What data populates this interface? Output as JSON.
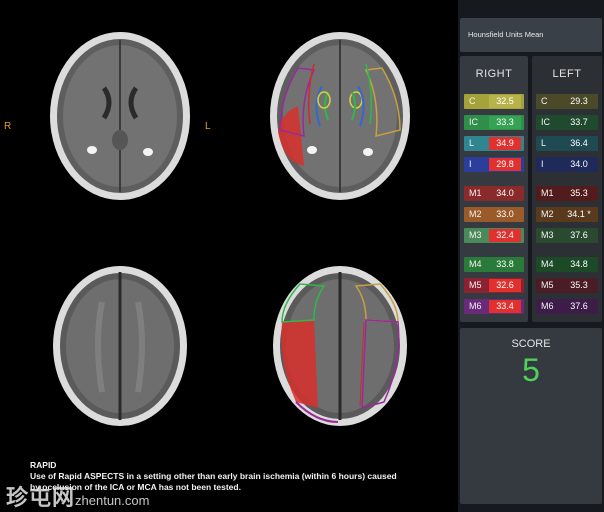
{
  "viewer": {
    "right_marker": "R",
    "left_marker": "L",
    "footer_title": "RAPID",
    "footer_line1": "Use of Rapid ASPECTS in a setting other than early brain ischemia (within 6 hours) caused",
    "footer_line2": "by occlusion of the ICA or MCA has not been tested."
  },
  "watermark": {
    "main": "珍屯网",
    "url": "zhentun.com"
  },
  "panel": {
    "header": "Hounsfield Units Mean",
    "right_title": "RIGHT",
    "left_title": "LEFT",
    "right_rows": [
      {
        "label": "C",
        "value": "32.5",
        "bg": "#a6a23a",
        "pill": "#b7b34a"
      },
      {
        "label": "IC",
        "value": "33.3",
        "bg": "#2f8f4a",
        "pill": "#36a253"
      },
      {
        "label": "L",
        "value": "34.9",
        "bg": "#2f8590",
        "pill": "#e2302e"
      },
      {
        "label": "I",
        "value": "29.8",
        "bg": "#2c3e9c",
        "pill": "#e2302e"
      },
      {
        "label": "M1",
        "value": "34.0",
        "bg": "#8a2a2a",
        "pill": "#8a2a2a"
      },
      {
        "label": "M2",
        "value": "33.0",
        "bg": "#9a5a2a",
        "pill": "#9a5a2a"
      },
      {
        "label": "M3",
        "value": "32.4",
        "bg": "#4a8a5a",
        "pill": "#e2302e"
      },
      {
        "label": "M4",
        "value": "33.8",
        "bg": "#2a7a3a",
        "pill": "#2a7a3a"
      },
      {
        "label": "M5",
        "value": "32.6",
        "bg": "#8a2232",
        "pill": "#e2302e"
      },
      {
        "label": "M6",
        "value": "33.4",
        "bg": "#6a2a7a",
        "pill": "#e2302e"
      }
    ],
    "left_rows": [
      {
        "label": "C",
        "value": "29.3",
        "bg": "#4a4a28",
        "pill": "#4a4a28"
      },
      {
        "label": "IC",
        "value": "33.7",
        "bg": "#1f4a2e",
        "pill": "#1f4a2e"
      },
      {
        "label": "L",
        "value": "36.4",
        "bg": "#1f4a52",
        "pill": "#1f4a52"
      },
      {
        "label": "I",
        "value": "34.0",
        "bg": "#1f2a5a",
        "pill": "#1f2a5a"
      },
      {
        "label": "M1",
        "value": "35.3",
        "bg": "#521c1c",
        "pill": "#521c1c"
      },
      {
        "label": "M2",
        "value": "34.1 *",
        "bg": "#5a3a1c",
        "pill": "#5a3a1c"
      },
      {
        "label": "M3",
        "value": "37.6",
        "bg": "#2a4a30",
        "pill": "#2a4a30"
      },
      {
        "label": "M4",
        "value": "34.8",
        "bg": "#1c4a26",
        "pill": "#1c4a26"
      },
      {
        "label": "M5",
        "value": "35.3",
        "bg": "#4a1c24",
        "pill": "#4a1c24"
      },
      {
        "label": "M6",
        "value": "37.6",
        "bg": "#3e1c4a",
        "pill": "#3e1c4a"
      }
    ],
    "score_label": "SCORE",
    "score_value": "5"
  }
}
